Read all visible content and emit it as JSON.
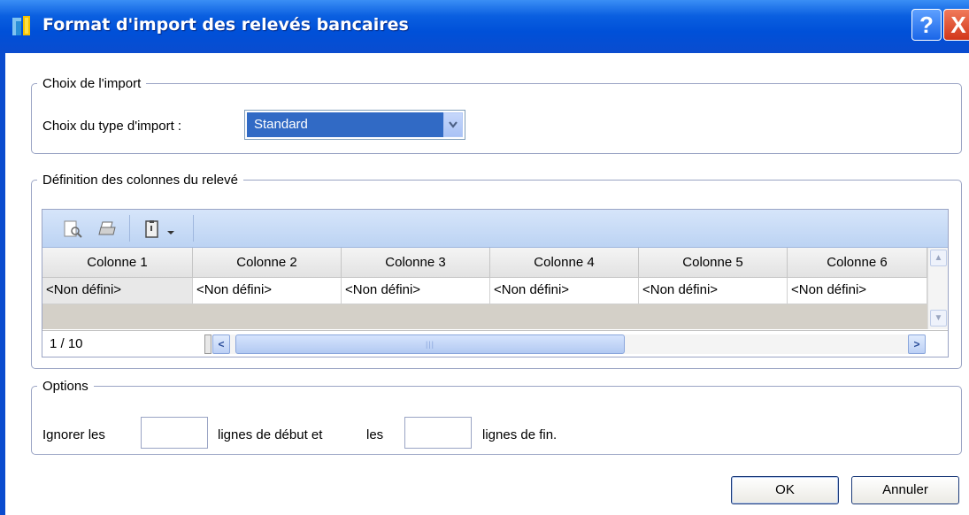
{
  "window": {
    "title": "Format d'import des relevés bancaires",
    "help_label": "?",
    "close_label": "X",
    "titlebar_color": "#0a5fe0"
  },
  "import_section": {
    "legend": "Choix de l'import",
    "type_label": "Choix du type d'import :",
    "type_value": "Standard"
  },
  "columns_section": {
    "legend": "Définition des colonnes du relevé",
    "toolbar_icons": [
      "preview-icon",
      "print-icon",
      "clipboard-icon",
      "dropdown-arrow-icon"
    ],
    "headers": [
      "Colonne 1",
      "Colonne 2",
      "Colonne 3",
      "Colonne 4",
      "Colonne 5",
      "Colonne 6"
    ],
    "row": [
      "<Non défini>",
      "<Non défini>",
      "<Non défini>",
      "<Non défini>",
      "<Non défini>",
      "<Non défini>"
    ],
    "pager": "1 / 10"
  },
  "options_section": {
    "legend": "Options",
    "ignore_label": "Ignorer les",
    "start_lines_label": "lignes de début et",
    "les_label": "les",
    "end_lines_label": "lignes de fin.",
    "start_lines_value": "",
    "end_lines_value": ""
  },
  "buttons": {
    "ok": "OK",
    "cancel": "Annuler"
  }
}
